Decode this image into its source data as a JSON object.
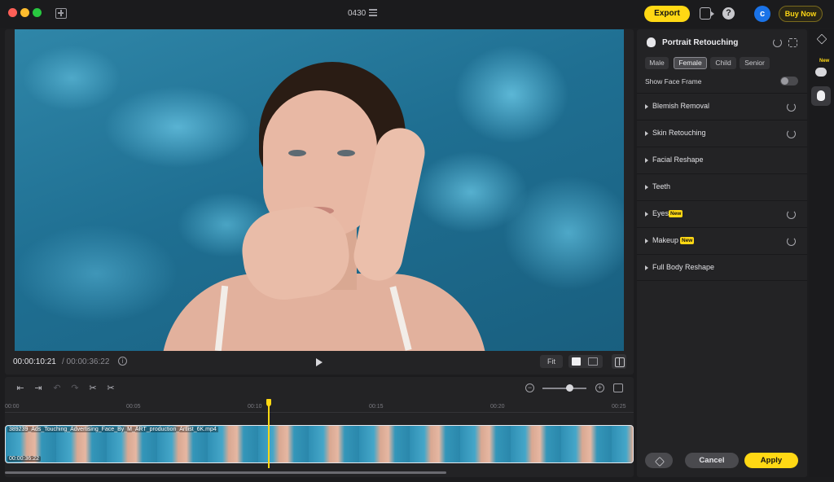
{
  "window": {
    "project_title": "0430",
    "export_label": "Export",
    "help_symbol": "?",
    "avatar_initial": "c",
    "buy_label": "Buy Now"
  },
  "preview": {
    "current_time": "00:00:10:21",
    "total_time": "/ 00:00:36:22",
    "fit_label": "Fit"
  },
  "timeline": {
    "ruler_labels": [
      "00:00",
      "00:05",
      "00:10",
      "00:15",
      "00:20",
      "00:25"
    ],
    "clip_name": "389239_Ads_Touching_Advertising_Face_By_M_ART_production_Artlist_6K.mp4",
    "clip_duration": "00:00:36:22",
    "playhead_time": "00:00:10:21"
  },
  "panel": {
    "title": "Portrait Retouching",
    "gender_options": [
      "Male",
      "Female",
      "Child",
      "Senior"
    ],
    "selected_gender": "Female",
    "show_face_frame_label": "Show Face Frame",
    "show_face_frame_on": false,
    "sections": [
      {
        "label": "Blemish Removal",
        "new": false,
        "reset": true
      },
      {
        "label": "Skin Retouching",
        "new": false,
        "reset": true
      },
      {
        "label": "Facial Reshape",
        "new": false,
        "reset": false
      },
      {
        "label": "Teeth",
        "new": false,
        "reset": false
      },
      {
        "label": "Eyes",
        "new": true,
        "reset": true
      },
      {
        "label": "Makeup",
        "new": true,
        "reset": true
      },
      {
        "label": "Full Body Reshape",
        "new": false,
        "reset": false
      }
    ],
    "new_badge": "New",
    "cancel_label": "Cancel",
    "apply_label": "Apply"
  },
  "rail": {
    "new_label": "New",
    "items": [
      "layers-icon",
      "palette-icon",
      "portrait-icon"
    ],
    "active_item": "portrait-icon"
  },
  "colors": {
    "accent": "#ffd814",
    "panel_bg": "#232325",
    "window_bg": "#1c1c1e",
    "avatar": "#1a73e8"
  }
}
